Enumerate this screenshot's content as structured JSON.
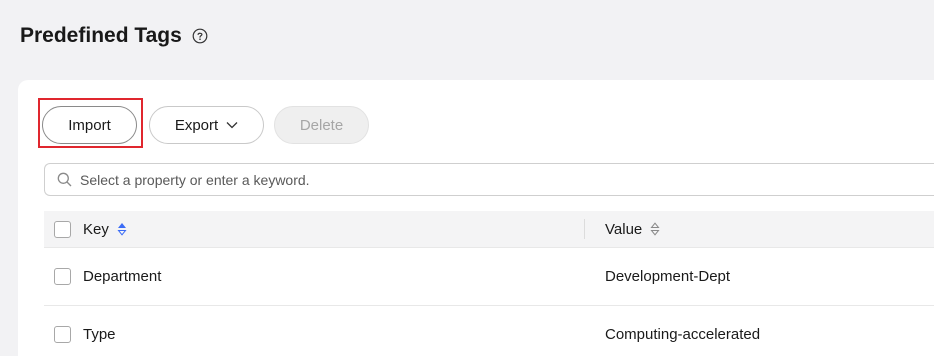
{
  "page": {
    "title": "Predefined Tags",
    "help_icon": "question-circle-icon"
  },
  "toolbar": {
    "import_label": "Import",
    "export_label": "Export",
    "export_icon": "chevron-down-icon",
    "delete_label": "Delete"
  },
  "search": {
    "placeholder": "Select a property or enter a keyword.",
    "value": "",
    "icon": "search-icon"
  },
  "table": {
    "columns": [
      {
        "label": "Key",
        "sort_icon": "sort-ascending-icon",
        "sorted": "ascending"
      },
      {
        "label": "Value",
        "sort_icon": "sort-icon",
        "sorted": "none"
      }
    ],
    "rows": [
      {
        "key": "Department",
        "value": "Development-Dept"
      },
      {
        "key": "Type",
        "value": "Computing-accelerated"
      }
    ]
  },
  "colors": {
    "highlight": "#e0262e",
    "sort_active": "#3b6cf6",
    "background": "#f2f2f4"
  }
}
